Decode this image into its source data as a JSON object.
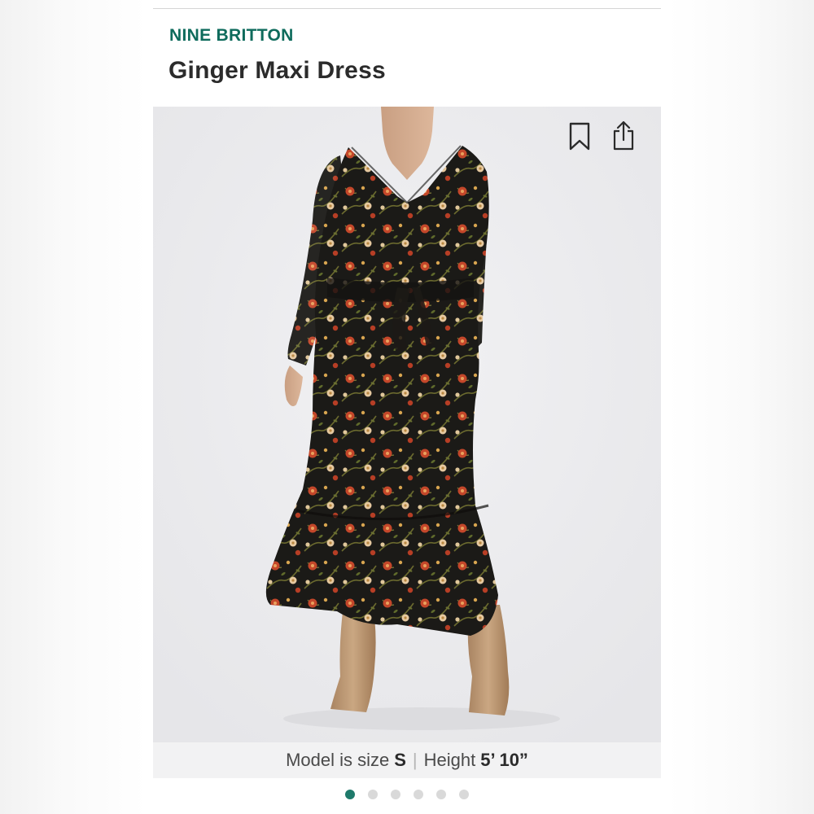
{
  "product": {
    "brand": "NINE BRITTON",
    "name": "Ginger Maxi Dress"
  },
  "image": {
    "description_icon": "dress-photo",
    "actions": {
      "bookmark_icon": "bookmark-icon",
      "share_icon": "share-icon"
    }
  },
  "model": {
    "size_label": "Model is size",
    "size_value": "S",
    "separator": "|",
    "height_label": "Height",
    "height_value": "5’ 10”"
  },
  "carousel": {
    "total": 6,
    "active_index": 0
  },
  "colors": {
    "brand": "#0e6b5c",
    "active_dot": "#1f7a6b",
    "inactive_dot": "#d9d9d9",
    "text_dark": "#2b2b2b"
  }
}
